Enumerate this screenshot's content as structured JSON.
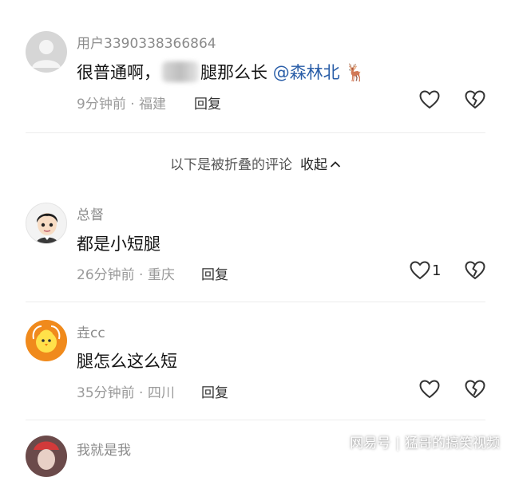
{
  "comments": [
    {
      "username": "用户3390338366864",
      "text_before": "很普通啊，",
      "text_after": "腿那么长",
      "mention": "@森林北",
      "time": "9分钟前",
      "location": "福建",
      "reply_label": "回复",
      "like_count": ""
    },
    {
      "username": "总督",
      "text": "都是小短腿",
      "time": "26分钟前",
      "location": "重庆",
      "reply_label": "回复",
      "like_count": "1"
    },
    {
      "username": "垚cc",
      "text": "腿怎么这么短",
      "time": "35分钟前",
      "location": "四川",
      "reply_label": "回复",
      "like_count": ""
    },
    {
      "username": "我就是我"
    }
  ],
  "meta_separator": " · ",
  "fold": {
    "label": "以下是被折叠的评论",
    "collapse_label": "收起",
    "collapse_icon": "chevron-up-icon"
  },
  "watermark": {
    "left": "网易号",
    "separator": "|",
    "right": "猛哥的搞笑视频"
  },
  "colors": {
    "username": "#8a8a8a",
    "mention": "#2a5ea8",
    "meta": "#9a9a9a",
    "avatar_orange": "#f08a1c"
  }
}
